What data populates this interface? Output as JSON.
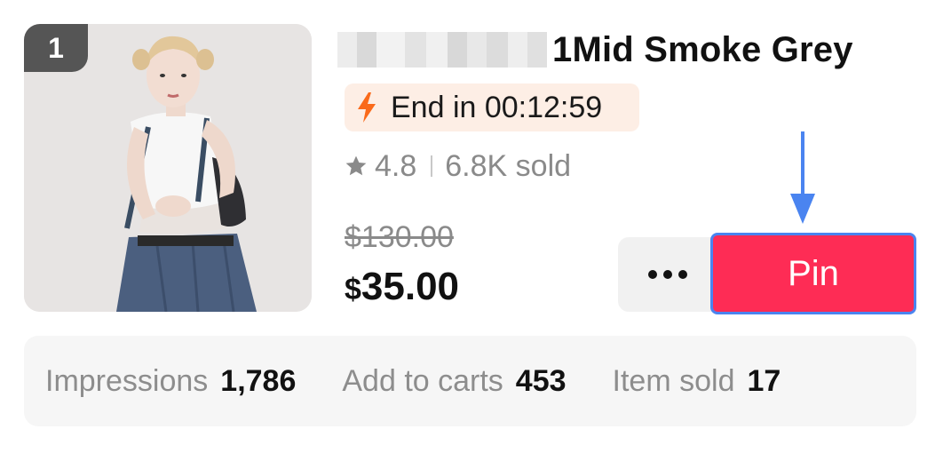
{
  "product": {
    "rank": "1",
    "title": "1Mid Smoke Grey",
    "countdown": "End in 00:12:59",
    "rating": "4.8",
    "sold": "6.8K sold",
    "original_price": "$130.00",
    "currency": "$",
    "price": "35.00"
  },
  "actions": {
    "pin_label": "Pin",
    "more_icon": "more-horizontal-icon"
  },
  "stats": [
    {
      "label": "Impressions",
      "value": "1,786"
    },
    {
      "label": "Add to carts",
      "value": "453"
    },
    {
      "label": "Item sold",
      "value": "17"
    }
  ],
  "colors": {
    "pin_button": "#fe2c55",
    "pin_highlight_border": "#4a84f0",
    "countdown_bg": "#fdeee5",
    "bolt": "#fa6a1a"
  },
  "icons": [
    "bolt-icon",
    "star-icon",
    "more-horizontal-icon",
    "arrow-down-annotation-icon"
  ]
}
